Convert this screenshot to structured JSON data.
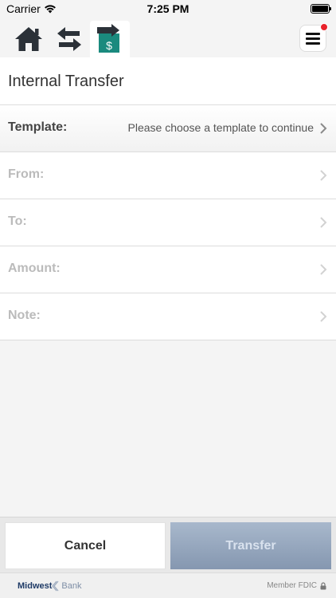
{
  "status_bar": {
    "carrier": "Carrier",
    "time": "7:25 PM",
    "battery_level": 1.0
  },
  "nav": {
    "icons": [
      "home-icon",
      "swap-arrows-icon",
      "transfer-dollar-icon",
      "hamburger-menu-icon"
    ],
    "active_tab": "transfer",
    "notification_color": "#e8212a"
  },
  "page": {
    "title": "Internal Transfer"
  },
  "form": {
    "template": {
      "label": "Template:",
      "value": "Please choose a template to continue"
    },
    "from": {
      "label": "From:",
      "value": ""
    },
    "to": {
      "label": "To:",
      "value": ""
    },
    "amount": {
      "label": "Amount:",
      "value": ""
    },
    "note": {
      "label": "Note:",
      "value": ""
    }
  },
  "buttons": {
    "cancel": "Cancel",
    "transfer": "Transfer"
  },
  "footer": {
    "logo_left": "Midwest",
    "logo_right": "Bank",
    "fdic": "Member FDIC"
  },
  "colors": {
    "accent_teal": "#1a8a7e",
    "icon_dark": "#2b3138",
    "transfer_button": "#8ea0b8"
  }
}
